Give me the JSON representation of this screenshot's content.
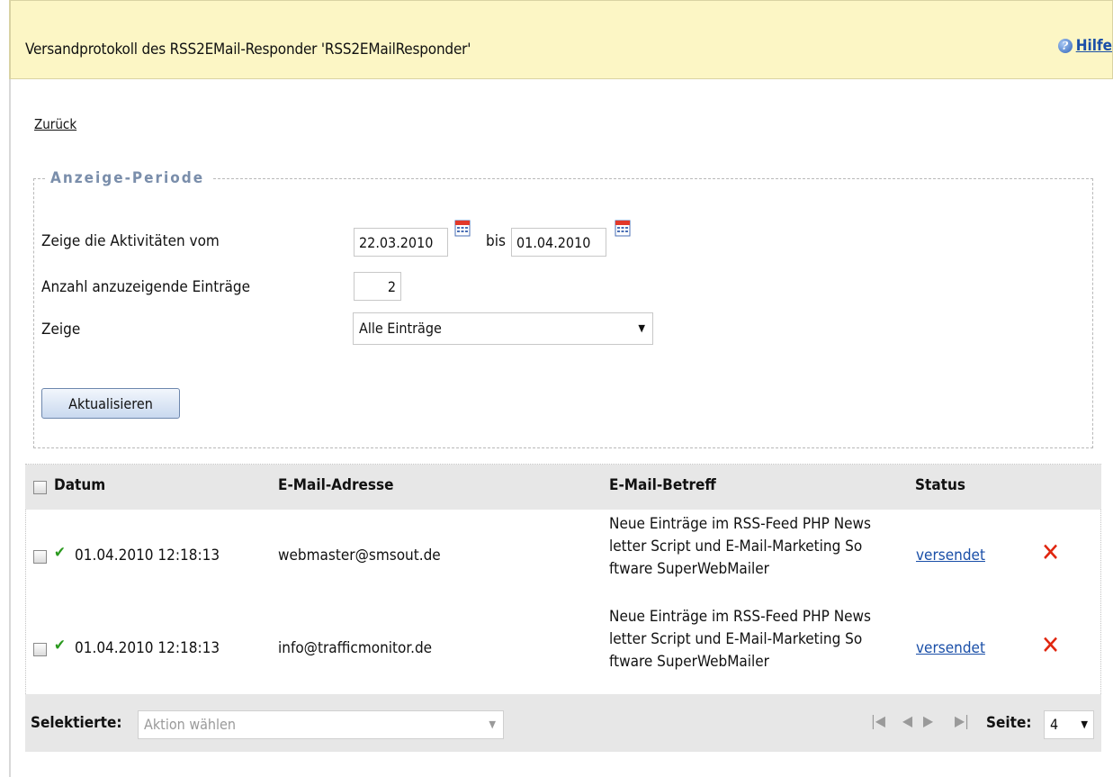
{
  "header": {
    "title": "Versandprotokoll des RSS2EMail-Responder 'RSS2EMailResponder'",
    "help_label": "Hilfe",
    "help_icon": "help-icon"
  },
  "nav": {
    "back_label": "Zurück"
  },
  "period": {
    "legend": "Anzeige-Periode",
    "from_label": "Zeige die Aktivitäten vom",
    "from_value": "22.03.2010",
    "to_label": "bis",
    "to_value": "01.04.2010",
    "count_label": "Anzahl anzuzeigende Einträge",
    "count_value": "2",
    "show_label": "Zeige",
    "show_value": "Alle Einträge",
    "refresh_label": "Aktualisieren"
  },
  "table": {
    "columns": [
      "Datum",
      "E-Mail-Adresse",
      "E-Mail-Betreff",
      "Status"
    ],
    "rows": [
      {
        "date": "01.04.2010 12:18:13",
        "email": "webmaster@smsout.de",
        "subject_lines": [
          "Neue Einträge im RSS-Feed PHP News",
          "letter Script und E-Mail-Marketing So",
          "ftware SuperWebMailer"
        ],
        "status": "versendet"
      },
      {
        "date": "01.04.2010 12:18:13",
        "email": "info@trafficmonitor.de",
        "subject_lines": [
          "Neue Einträge im RSS-Feed PHP News",
          "letter Script und E-Mail-Marketing So",
          "ftware SuperWebMailer"
        ],
        "status": "versendet"
      }
    ]
  },
  "footer": {
    "selected_label": "Selektierte:",
    "action_placeholder": "Aktion wählen",
    "page_label": "Seite:",
    "page_value": "4"
  },
  "colors": {
    "header_bg": "#fcf6c5",
    "link": "#1a4fa8",
    "success": "#2b9a1f",
    "delete": "#e0260f",
    "table_header_bg": "#e7e7e7"
  }
}
